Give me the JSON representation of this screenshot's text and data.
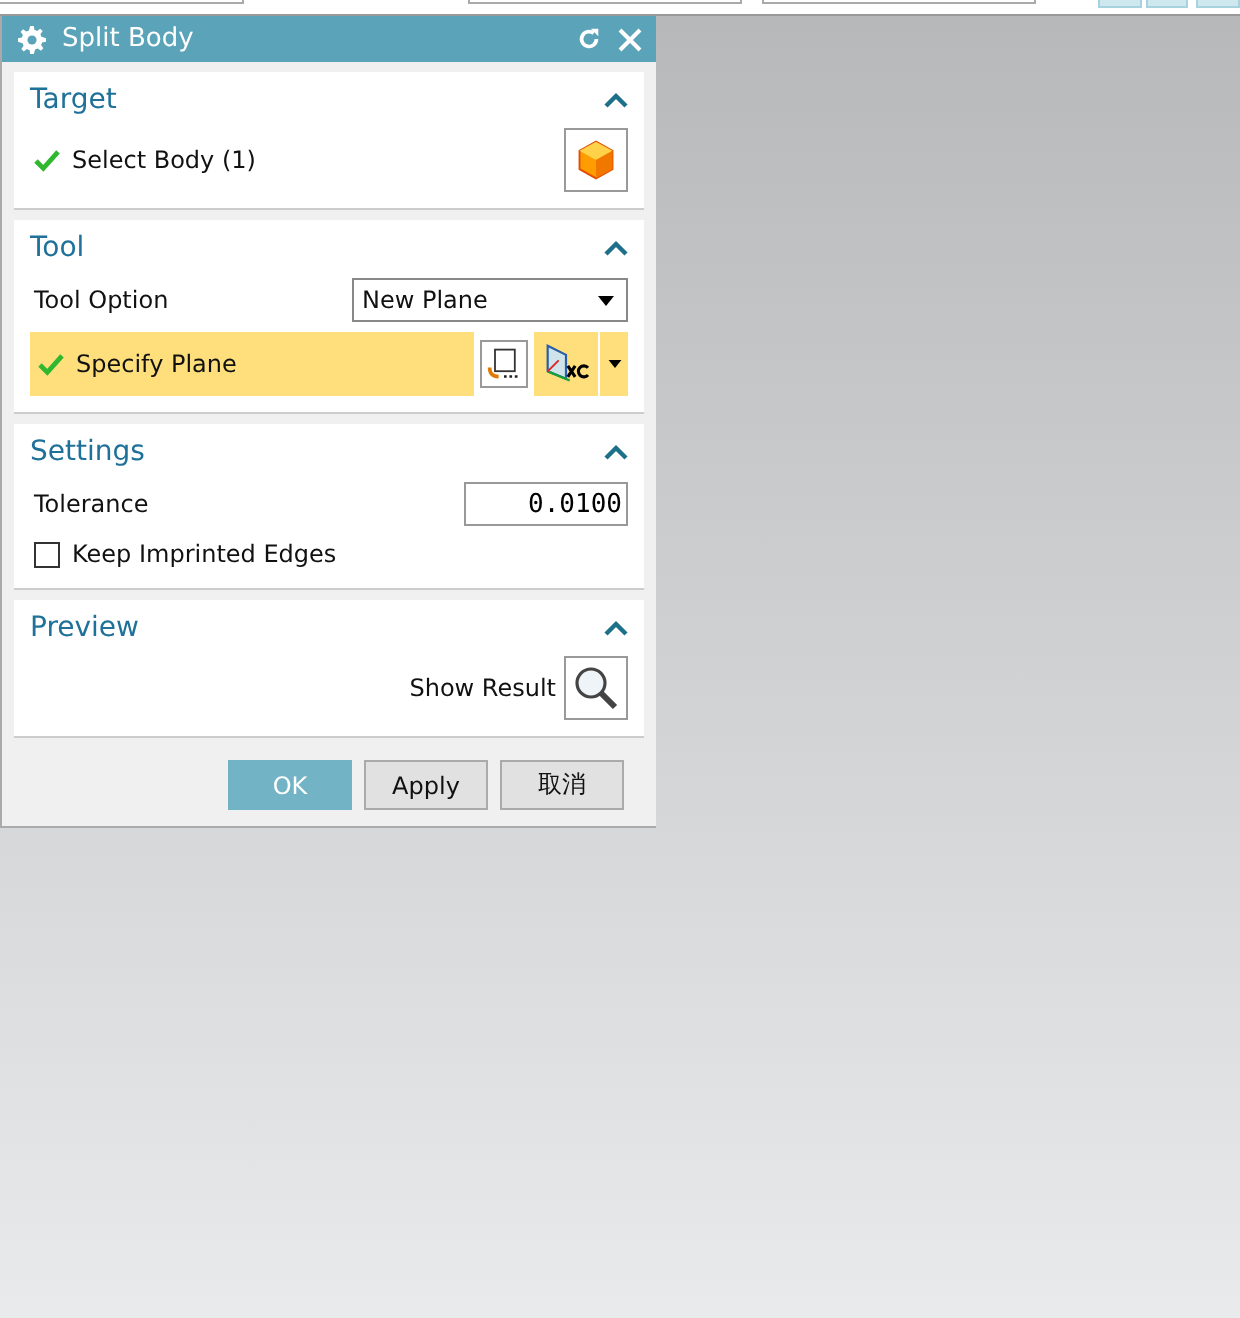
{
  "window": {
    "title": "Split Body"
  },
  "target": {
    "title": "Target",
    "expanded": true,
    "select_body": {
      "label": "Select Body (1)",
      "complete": true
    }
  },
  "tool": {
    "title": "Tool",
    "expanded": true,
    "tool_option": {
      "label": "Tool Option",
      "value": "New Plane"
    },
    "specify_plane": {
      "label": "Specify Plane",
      "complete": true
    }
  },
  "settings": {
    "title": "Settings",
    "expanded": true,
    "tolerance": {
      "label": "Tolerance",
      "value": "0.0100"
    },
    "keep_imprinted_edges": {
      "label": "Keep Imprinted Edges",
      "checked": false
    }
  },
  "preview": {
    "title": "Preview",
    "expanded": true,
    "show_result": {
      "label": "Show Result"
    }
  },
  "buttons": [
    {
      "label": "OK",
      "kind": "primary"
    },
    {
      "label": "Apply",
      "kind": "normal"
    },
    {
      "label": "取消",
      "kind": "normal"
    }
  ]
}
